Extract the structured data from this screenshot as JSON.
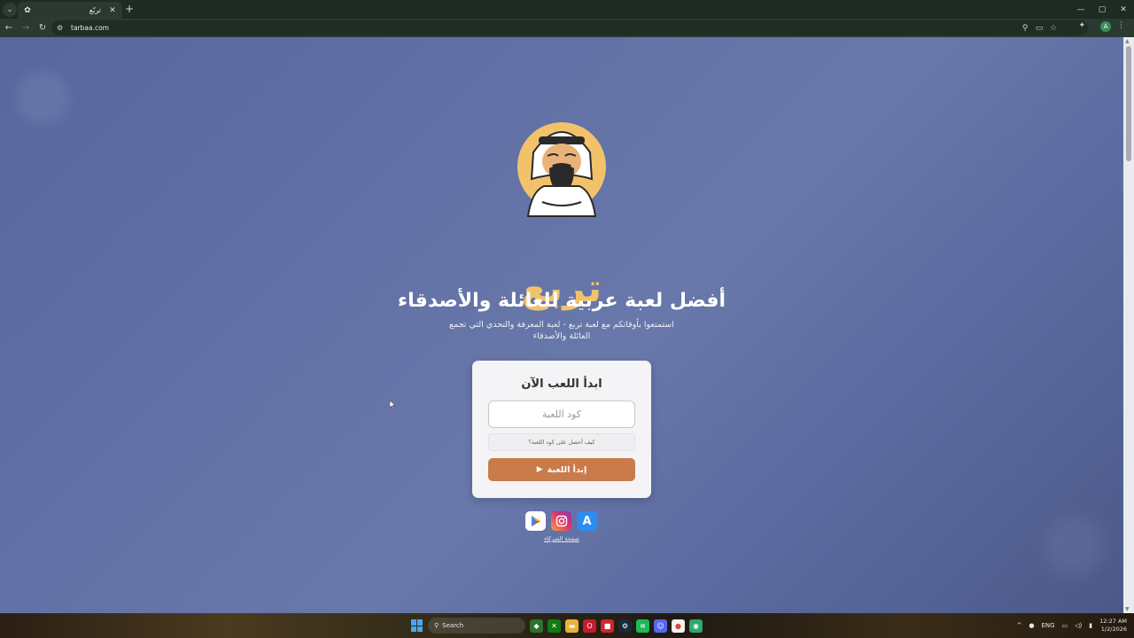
{
  "browser": {
    "tab_title": "تربّع",
    "url": "tarbaa.com",
    "new_tab_symbol": "+",
    "close_symbol": "✕",
    "icons": [
      "tab-search-icon",
      "site-favicon",
      "back-icon",
      "forward-icon",
      "reload-icon",
      "site-info-icon",
      "zoom-icon",
      "cast-icon",
      "bookmark-star-icon",
      "extensions-icon",
      "profile-icon",
      "menu-icon",
      "minimize-icon",
      "maximize-icon",
      "close-icon"
    ],
    "profile_initial": "A"
  },
  "page": {
    "brand": "تربع",
    "headline": "أفضل لعبة عربية للعائلة والأصدقاء",
    "subline": "استمتعوا بأوقاتكم مع لعبة تربع - لعبة المعرفة والتحدي التي تجمع العائلة والأصدقاء",
    "card": {
      "title": "ابدأ اللعب الآن",
      "code_placeholder": "كود اللعبة",
      "code_value": "",
      "help_link": "كيف أحصل على كود اللعبة؟",
      "start_button": "إبدأ اللعبة"
    },
    "stores": [
      "google-play-icon",
      "instagram-icon",
      "app-store-icon"
    ],
    "partners_link": "صفحة الشركاء",
    "colors": {
      "background": "#6272a6",
      "accent": "#c97b4a",
      "brand_gold": "#f2c26b",
      "card": "#f4f4f6"
    }
  },
  "taskbar": {
    "search_label": "Search",
    "language": "ENG",
    "time": "12:27 AM",
    "date": "1/2/2026"
  }
}
